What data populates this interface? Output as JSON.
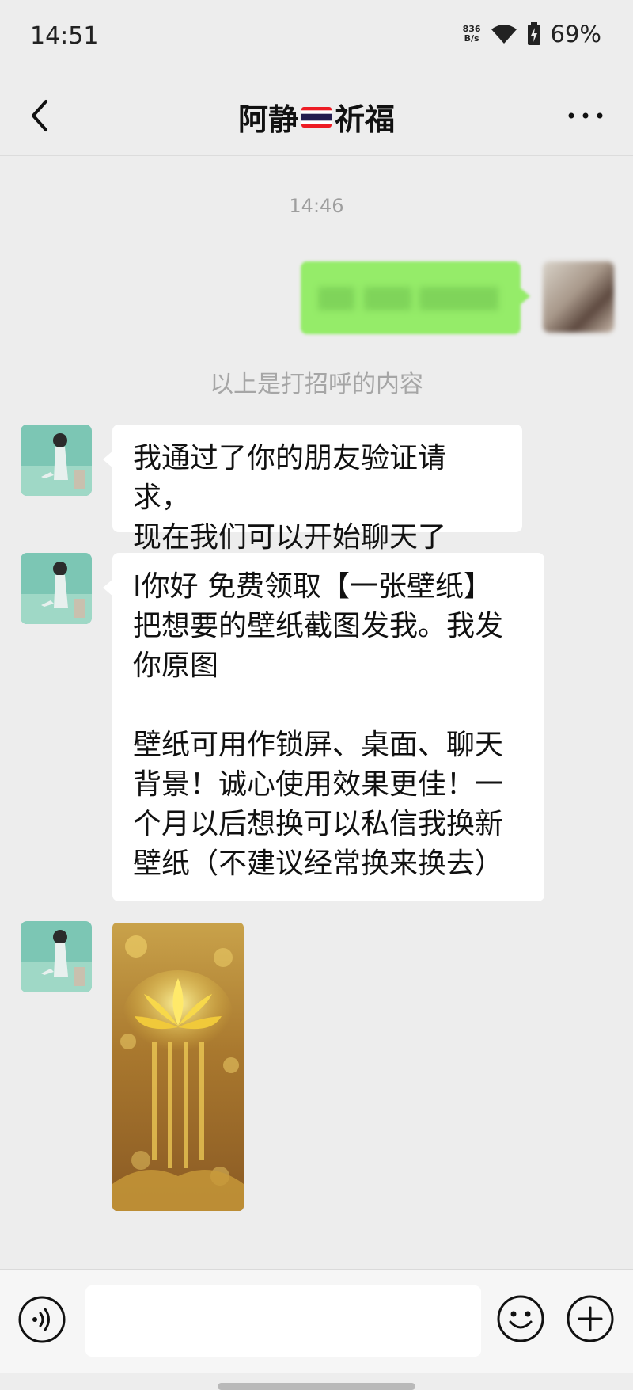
{
  "status_bar": {
    "time": "14:51",
    "net_speed_value": "836",
    "net_speed_unit": "B/s",
    "battery": "69%"
  },
  "nav": {
    "title_part1": "阿静",
    "title_part2": "祈福",
    "flag": "thailand-flag"
  },
  "chat": {
    "timestamp": "14:46",
    "system_note": "以上是打招呼的内容",
    "messages": [
      {
        "type": "text",
        "text": "我通过了你的朋友验证请求，\n现在我们可以开始聊天了"
      },
      {
        "type": "text",
        "text": "I你好 免费领取【一张壁纸】\n把想要的壁纸截图发我。我发\n你原图\n\n壁纸可用作锁屏、桌面、聊天\n背景！诚心使用效果更佳！一\n个月以后想换可以私信我换新\n壁纸（不建议经常换来换去）"
      },
      {
        "type": "image",
        "icon": "golden-lotus-wallpaper"
      }
    ]
  },
  "input_bar": {
    "placeholder": "",
    "voice_icon": "voice-icon",
    "emoji_icon": "emoji-icon",
    "plus_icon": "plus-icon"
  },
  "colors": {
    "background": "#ededed",
    "sent_bubble": "#95ec69",
    "received_bubble": "#ffffff",
    "gray_text": "#a6a6a6"
  }
}
